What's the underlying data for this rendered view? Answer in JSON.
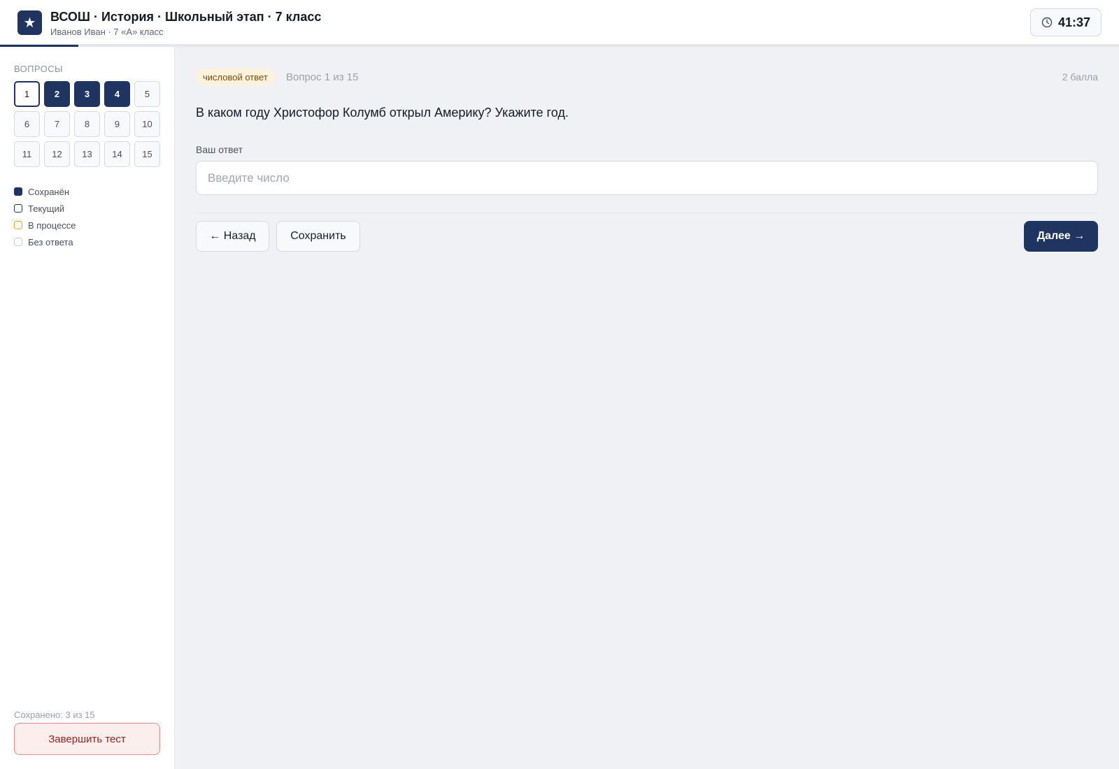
{
  "header": {
    "logo_glyph": "★",
    "title": "ВСОШ · История · Школьный этап · 7 класс",
    "subtitle": "Иванов Иван · 7 «А» класс",
    "timer": "41:37",
    "timer_icon": "clock-icon",
    "progress_fraction": 0.07
  },
  "sidebar": {
    "title": "ВОПРОСЫ",
    "questions": [
      {
        "label": "1",
        "state": "current"
      },
      {
        "label": "2",
        "state": "saved"
      },
      {
        "label": "3",
        "state": "saved"
      },
      {
        "label": "4",
        "state": "saved"
      },
      {
        "label": "5",
        "state": "empty"
      },
      {
        "label": "6",
        "state": "empty"
      },
      {
        "label": "7",
        "state": "empty"
      },
      {
        "label": "8",
        "state": "empty"
      },
      {
        "label": "9",
        "state": "empty"
      },
      {
        "label": "10",
        "state": "empty"
      },
      {
        "label": "11",
        "state": "empty"
      },
      {
        "label": "12",
        "state": "empty"
      },
      {
        "label": "13",
        "state": "empty"
      },
      {
        "label": "14",
        "state": "empty"
      },
      {
        "label": "15",
        "state": "empty"
      }
    ],
    "legend": [
      {
        "label": "Сохранён",
        "kind": "saved"
      },
      {
        "label": "Текущий",
        "kind": "current"
      },
      {
        "label": "В процессе",
        "kind": "progress"
      },
      {
        "label": "Без ответа",
        "kind": "empty"
      }
    ],
    "saved_count": "Сохранено: 3 из 15",
    "finish_label": "Завершить тест"
  },
  "main": {
    "type_tag": "числовой ответ",
    "counter": "Вопрос 1 из 15",
    "points": "2 балла",
    "question_text": "В каком году Христофор Колумб открыл Америку? Укажите год.",
    "answer_label": "Ваш ответ",
    "answer_value": "",
    "answer_placeholder": "Введите число",
    "back_label": "← Назад",
    "save_label": "Сохранить",
    "next_label": "Далее →"
  },
  "colors": {
    "accent": "#1f3461",
    "background": "#f0f1f4",
    "danger": "#9b2222",
    "tag_bg": "#fdf3dc",
    "progress_legend": "#e2a92a"
  }
}
